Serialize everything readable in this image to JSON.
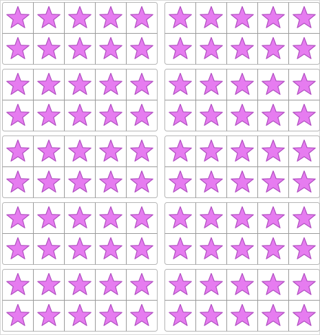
{
  "layout": {
    "frame_rows": 5,
    "frame_cols": 2,
    "cells_per_row": 5,
    "rows_per_frame": 2
  },
  "frames": [
    {
      "stars": 10
    },
    {
      "stars": 10
    },
    {
      "stars": 10
    },
    {
      "stars": 10
    },
    {
      "stars": 10
    },
    {
      "stars": 10
    },
    {
      "stars": 10
    },
    {
      "stars": 10
    },
    {
      "stars": 10
    },
    {
      "stars": 10
    }
  ],
  "total_stars": 100,
  "colors": {
    "star_fill": "#e67cf0",
    "star_stroke": "#b04fc0",
    "grid_line": "#9a9a9a",
    "frame_border": "#b5b5b5",
    "background": "#ffffff"
  },
  "icons": {
    "cell": "star-icon"
  }
}
